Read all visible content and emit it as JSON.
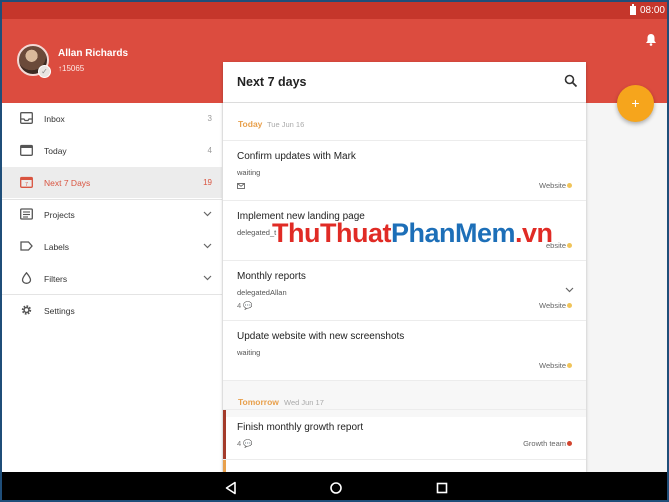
{
  "status_bar": {
    "time": "08:00"
  },
  "user": {
    "name": "Allan Richards",
    "karma": "↑15065"
  },
  "sidebar": {
    "items": [
      {
        "label": "Inbox",
        "count": "3",
        "icon": "inbox-icon"
      },
      {
        "label": "Today",
        "count": "4",
        "icon": "calendar-icon"
      },
      {
        "label": "Next 7 Days",
        "count": "19",
        "icon": "calendar-week-icon"
      },
      {
        "label": "Projects",
        "icon": "projects-icon"
      },
      {
        "label": "Labels",
        "icon": "label-icon"
      },
      {
        "label": "Filters",
        "icon": "filter-drop-icon"
      },
      {
        "label": "Settings",
        "icon": "gear-icon"
      }
    ]
  },
  "panel": {
    "title": "Next 7 days",
    "sections": [
      {
        "label": "Today",
        "date": "Tue Jun 16"
      },
      {
        "label": "Tomorrow",
        "date": "Wed Jun 17"
      }
    ],
    "tasks": [
      {
        "title": "Confirm updates with Mark",
        "sub": "waiting",
        "meta": "",
        "project": "Website",
        "dot": "#f0c45a"
      },
      {
        "title": "Implement new landing page",
        "sub": "delegated_t",
        "meta": "",
        "project": "ebsite",
        "dot": "#f0c45a"
      },
      {
        "title": "Monthly reports",
        "sub": "delegatedAllan",
        "meta": "4",
        "project": "Website",
        "dot": "#f0c45a"
      },
      {
        "title": "Update website with new screenshots",
        "sub": "waiting",
        "meta": "",
        "project": "Website",
        "dot": "#f0c45a"
      },
      {
        "title": "Finish monthly growth report",
        "sub": "",
        "meta": "4",
        "project": "Growth team",
        "dot": "#d2452f"
      }
    ]
  },
  "fab": {
    "label": "+"
  },
  "watermark": {
    "part1": "ThuThuat",
    "part2": "PhanMem",
    "part3": ".vn"
  },
  "colors": {
    "header": "#dc4c3f",
    "status_bar": "#c5362b",
    "accent": "#d9533f",
    "fab": "#f6a51c",
    "today": "#e8a04c"
  }
}
